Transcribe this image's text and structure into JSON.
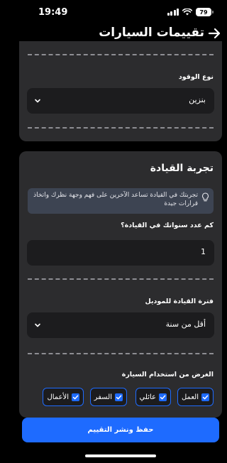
{
  "status": {
    "time": "19:49",
    "battery": "79"
  },
  "nav": {
    "title": "تقييمات السيارات"
  },
  "fuel": {
    "label": "نوع الوقود",
    "value": "بنزين"
  },
  "driving": {
    "title": "تجربة القيادة",
    "tip": "تجربتك في القيادة تساعد الآخرين على فهم وجهة نظرك واتخاذ قرارات جيدة",
    "years_label": "كم عدد سنواتك في القيادة؟",
    "years_value": "1",
    "period_label": "فترة القيادة للموديل",
    "period_value": "أقل من سنة",
    "purpose_label": "الغرض من استخدام السيارة",
    "purposes": [
      "العمل",
      "عائلي",
      "السفر",
      "الأعمال"
    ]
  },
  "actions": {
    "save_label": "حفظ ونشر التقييم"
  },
  "colors": {
    "accent": "#1e6bff",
    "card": "#2c2c2e",
    "field": "#1c1c1e",
    "tip_bg": "#3d4452"
  }
}
